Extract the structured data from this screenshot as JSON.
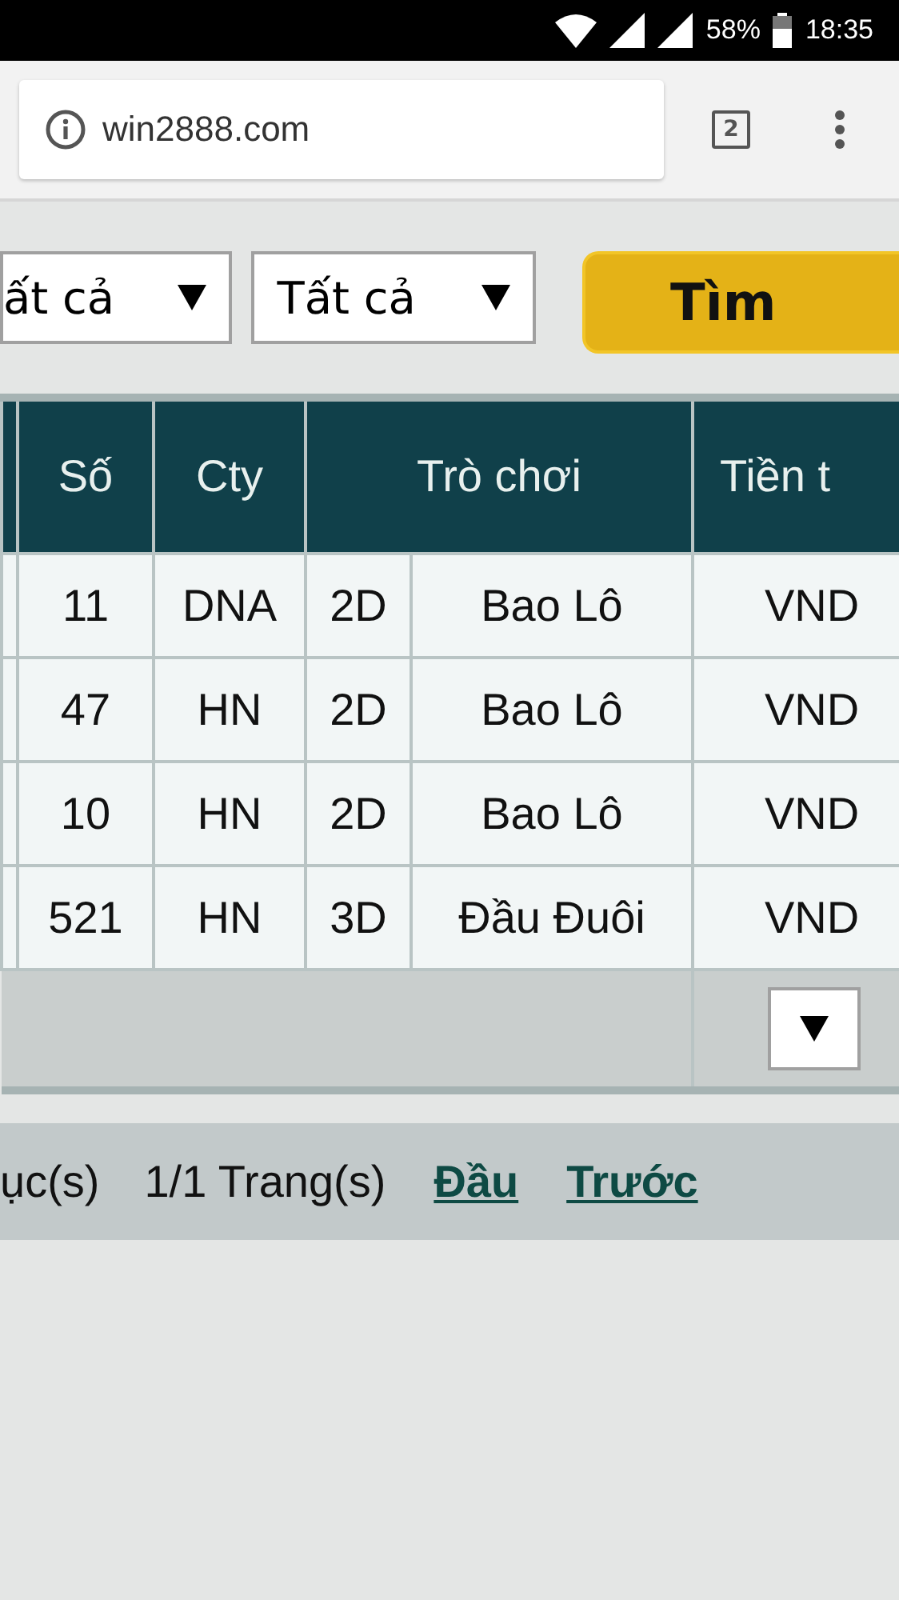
{
  "status_bar": {
    "battery": "58%",
    "time": "18:35"
  },
  "browser": {
    "url": "win2888.com",
    "tab_count": "2"
  },
  "filters": [
    {
      "value": "ất cả"
    },
    {
      "value": "Tất cả"
    }
  ],
  "search_button": "Tìm",
  "table": {
    "columns": [
      "Số",
      "Cty",
      "Trò chơi",
      "Tiền t"
    ],
    "rows": [
      {
        "number": "11",
        "company": "DNA",
        "type": "2D",
        "game": "Bao Lô",
        "currency": "VND"
      },
      {
        "number": "47",
        "company": "HN",
        "type": "2D",
        "game": "Bao Lô",
        "currency": "VND"
      },
      {
        "number": "10",
        "company": "HN",
        "type": "2D",
        "game": "Bao Lô",
        "currency": "VND"
      },
      {
        "number": "521",
        "company": "HN",
        "type": "3D",
        "game": "Đầu Đuôi",
        "currency": "VND"
      }
    ]
  },
  "pager": {
    "records": "ục(s)",
    "pages": "1/1 Trang(s)",
    "links": [
      "Đầu",
      "Trước"
    ]
  }
}
